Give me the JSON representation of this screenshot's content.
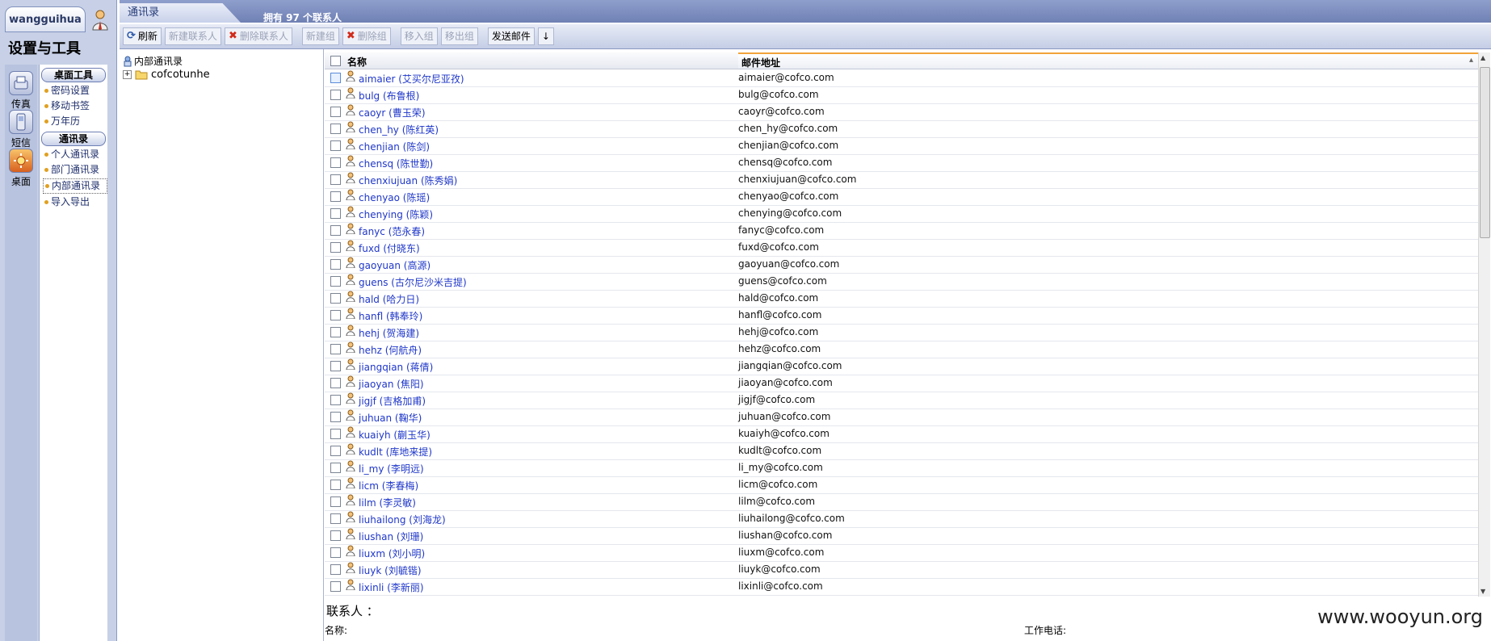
{
  "user": {
    "name": "wangguihua"
  },
  "sidebar": {
    "title": "设置与工具",
    "icons": [
      {
        "label": "传真",
        "icon": "fax-icon"
      },
      {
        "label": "短信",
        "icon": "phone-icon"
      },
      {
        "label": "桌面",
        "icon": "desktop-icon"
      }
    ],
    "groups": [
      {
        "label": "桌面工具",
        "items": [
          "密码设置",
          "移动书签",
          "万年历"
        ]
      },
      {
        "label": "通讯录",
        "items": [
          "个人通讯录",
          "部门通讯录",
          "内部通讯录",
          "导入导出"
        ]
      }
    ]
  },
  "header": {
    "tab": "通讯录",
    "count_text": "拥有  97 个联系人"
  },
  "toolbar": {
    "refresh": "刷新",
    "new_contact": "新建联系人",
    "delete_contact": "删除联系人",
    "new_group": "新建组",
    "delete_group": "删除组",
    "move_group": "移入组",
    "remove_group": "移出组",
    "send_mail": "发送邮件",
    "arrow": "↓"
  },
  "tree": {
    "root": "内部通讯录",
    "child": "cofcotunhe"
  },
  "grid": {
    "col_name": "名称",
    "col_mail": "邮件地址",
    "rows": [
      {
        "name": "aimaier (艾买尔尼亚孜)",
        "mail": "aimaier@cofco.com"
      },
      {
        "name": "bulg (布鲁根)",
        "mail": "bulg@cofco.com"
      },
      {
        "name": "caoyr (曹玉荣)",
        "mail": "caoyr@cofco.com"
      },
      {
        "name": "chen_hy (陈红英)",
        "mail": "chen_hy@cofco.com"
      },
      {
        "name": "chenjian (陈剑)",
        "mail": "chenjian@cofco.com"
      },
      {
        "name": "chensq (陈世勤)",
        "mail": "chensq@cofco.com"
      },
      {
        "name": "chenxiujuan (陈秀娟)",
        "mail": "chenxiujuan@cofco.com"
      },
      {
        "name": "chenyao (陈瑶)",
        "mail": "chenyao@cofco.com"
      },
      {
        "name": "chenying (陈颖)",
        "mail": "chenying@cofco.com"
      },
      {
        "name": "fanyc (范永春)",
        "mail": "fanyc@cofco.com"
      },
      {
        "name": "fuxd (付晓东)",
        "mail": "fuxd@cofco.com"
      },
      {
        "name": "gaoyuan (高源)",
        "mail": "gaoyuan@cofco.com"
      },
      {
        "name": "guens (古尔尼沙米吉提)",
        "mail": "guens@cofco.com"
      },
      {
        "name": "hald (哈力日)",
        "mail": "hald@cofco.com"
      },
      {
        "name": "hanfl (韩奉玲)",
        "mail": "hanfl@cofco.com"
      },
      {
        "name": "hehj (贺海建)",
        "mail": "hehj@cofco.com"
      },
      {
        "name": "hehz (何航舟)",
        "mail": "hehz@cofco.com"
      },
      {
        "name": "jiangqian (蒋倩)",
        "mail": "jiangqian@cofco.com"
      },
      {
        "name": "jiaoyan (焦阳)",
        "mail": "jiaoyan@cofco.com"
      },
      {
        "name": "jigjf (吉格加甫)",
        "mail": "jigjf@cofco.com"
      },
      {
        "name": "juhuan (鞠华)",
        "mail": "juhuan@cofco.com"
      },
      {
        "name": "kuaiyh (蒯玉华)",
        "mail": "kuaiyh@cofco.com"
      },
      {
        "name": "kudlt (库地来提)",
        "mail": "kudlt@cofco.com"
      },
      {
        "name": "li_my (李明远)",
        "mail": "li_my@cofco.com"
      },
      {
        "name": "licm (李春梅)",
        "mail": "licm@cofco.com"
      },
      {
        "name": "lilm (李灵敏)",
        "mail": "lilm@cofco.com"
      },
      {
        "name": "liuhailong (刘海龙)",
        "mail": "liuhailong@cofco.com"
      },
      {
        "name": "liushan (刘珊)",
        "mail": "liushan@cofco.com"
      },
      {
        "name": "liuxm (刘小明)",
        "mail": "liuxm@cofco.com"
      },
      {
        "name": "liuyk (刘毓锴)",
        "mail": "liuyk@cofco.com"
      },
      {
        "name": "lixinli (李新丽)",
        "mail": "lixinli@cofco.com"
      }
    ]
  },
  "detail": {
    "title": "联系人  ：",
    "name_label": "名称:",
    "work_phone_label": "工作电话:"
  },
  "watermark": "www.wooyun.org"
}
